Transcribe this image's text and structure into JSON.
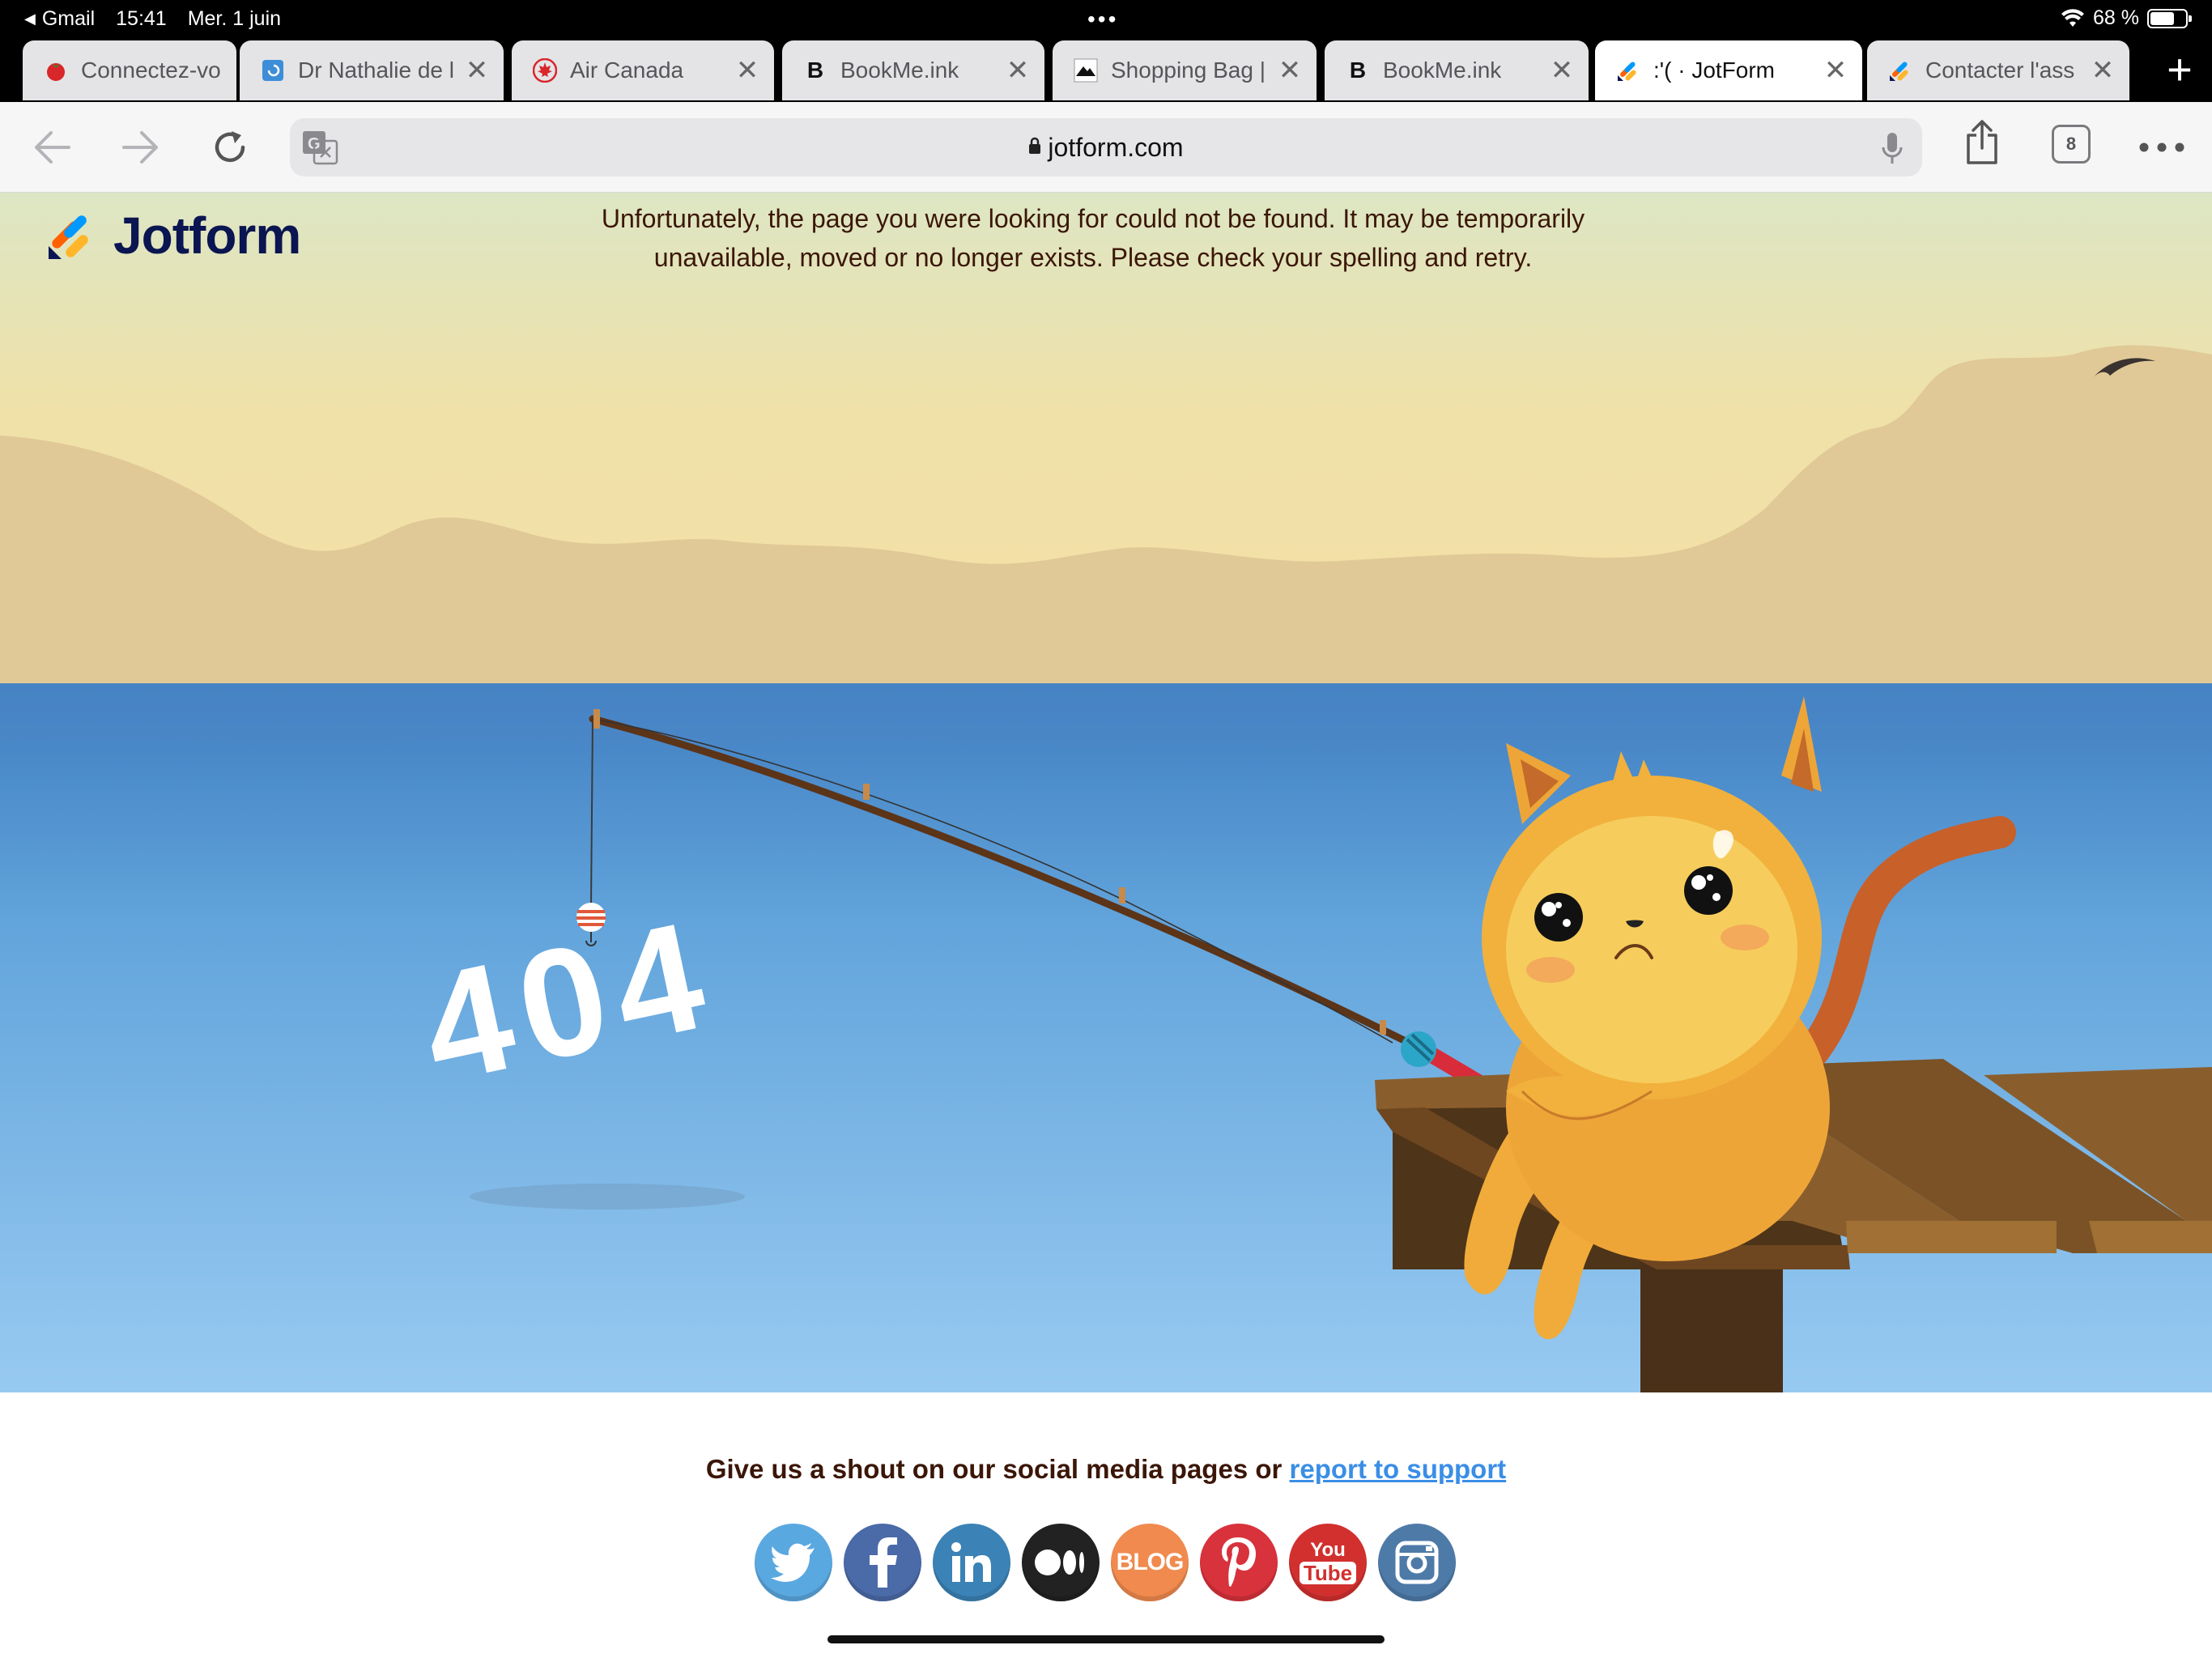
{
  "status_bar": {
    "back_app": "Gmail",
    "time": "15:41",
    "date": "Mer. 1 juin",
    "battery": "68 %",
    "battery_level": 0.68
  },
  "tabs": [
    {
      "label": "Connectez-vo",
      "icon": "tomato-icon",
      "active": false
    },
    {
      "label": "Dr Nathalie de l",
      "icon": "clinic-icon",
      "active": false
    },
    {
      "label": "Air Canada",
      "icon": "maple-leaf-icon",
      "active": false
    },
    {
      "label": "BookMe.ink",
      "icon": "b-letter-icon",
      "active": false
    },
    {
      "label": "Shopping Bag |",
      "icon": "mountain-icon",
      "active": false
    },
    {
      "label": "BookMe.ink",
      "icon": "b-letter-icon",
      "active": false
    },
    {
      "label": ":'( · JotForm",
      "icon": "jotform-icon",
      "active": true
    },
    {
      "label": "Contacter l'ass",
      "icon": "jotform-icon",
      "active": false
    }
  ],
  "toolbar": {
    "url": "jotform.com",
    "tab_count": "8"
  },
  "page": {
    "logo_text": "Jotform",
    "message": "Unfortunately, the page you were looking for could not be found. It may be temporarily unavailable, moved or no longer exists. Please check your spelling and retry.",
    "error_code": "404",
    "shout_text": "Give us a shout on our social media pages or",
    "support_link": "report to support",
    "socials": [
      {
        "name": "twitter-icon",
        "color": "#5aa8e0"
      },
      {
        "name": "facebook-icon",
        "color": "#4a6aa8"
      },
      {
        "name": "linkedin-icon",
        "color": "#3b82b6"
      },
      {
        "name": "medium-icon",
        "color": "#222222"
      },
      {
        "name": "blog-icon",
        "label": "BLOG",
        "color": "#f08a4e"
      },
      {
        "name": "pinterest-icon",
        "color": "#d8323c"
      },
      {
        "name": "youtube-icon",
        "label_top": "You",
        "label_bottom": "Tube",
        "color": "#d1302f"
      },
      {
        "name": "instagram-icon",
        "color": "#4e7aa8"
      }
    ]
  }
}
